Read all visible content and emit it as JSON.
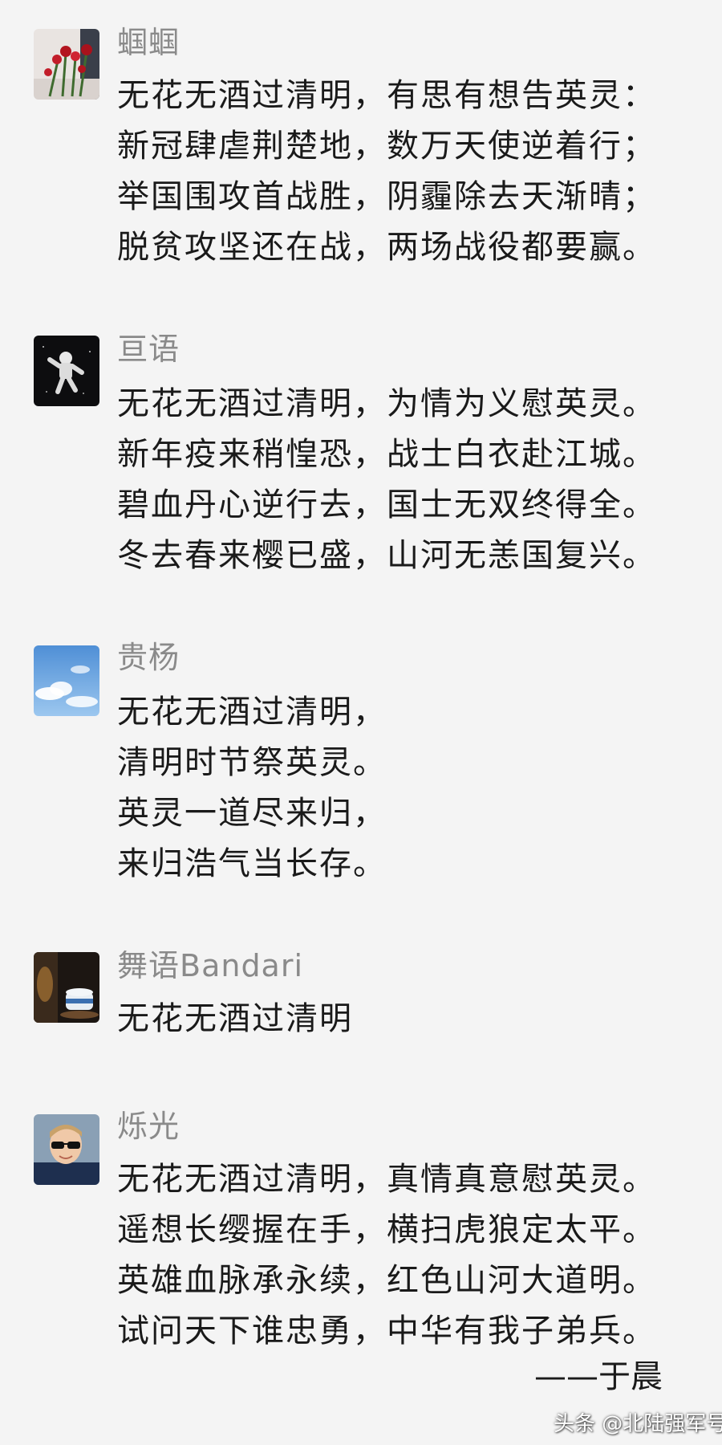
{
  "posts": [
    {
      "author": "蝈蝈",
      "avatar": "roses-avatar",
      "lines": [
        "无花无酒过清明，有思有想告英灵：",
        "新冠肆虐荆楚地，数万天使逆着行；",
        "举国围攻首战胜，阴霾除去天渐晴；",
        "脱贫攻坚还在战，两场战役都要赢。"
      ]
    },
    {
      "author": "亘语",
      "avatar": "astronaut-avatar",
      "lines": [
        "无花无酒过清明，为情为义慰英灵。",
        "新年疫来稍惶恐，战士白衣赴江城。",
        "碧血丹心逆行去，国士无双终得全。",
        "冬去春来樱已盛，山河无恙国复兴。"
      ]
    },
    {
      "author": "贵杨",
      "avatar": "sky-clouds-avatar",
      "lines": [
        "无花无酒过清明，",
        "清明时节祭英灵。",
        "英灵一道尽来归，",
        "来归浩气当长存。"
      ]
    },
    {
      "author": "舞语Bandari",
      "avatar": "teacup-avatar",
      "lines": [
        "无花无酒过清明"
      ]
    },
    {
      "author": "烁光",
      "avatar": "boy-sunglasses-avatar",
      "lines": [
        "无花无酒过清明，真情真意慰英灵。",
        "遥想长缨握在手，横扫虎狼定太平。",
        "英雄血脉承永续，红色山河大道明。",
        "试问天下谁忠勇，中华有我子弟兵。"
      ]
    }
  ],
  "signature": "——于晨",
  "watermark": "头条 @北陆强军号",
  "colors": {
    "background": "#f4f4f4",
    "author_name": "#8a8a8a",
    "text": "#1a1a1a"
  }
}
